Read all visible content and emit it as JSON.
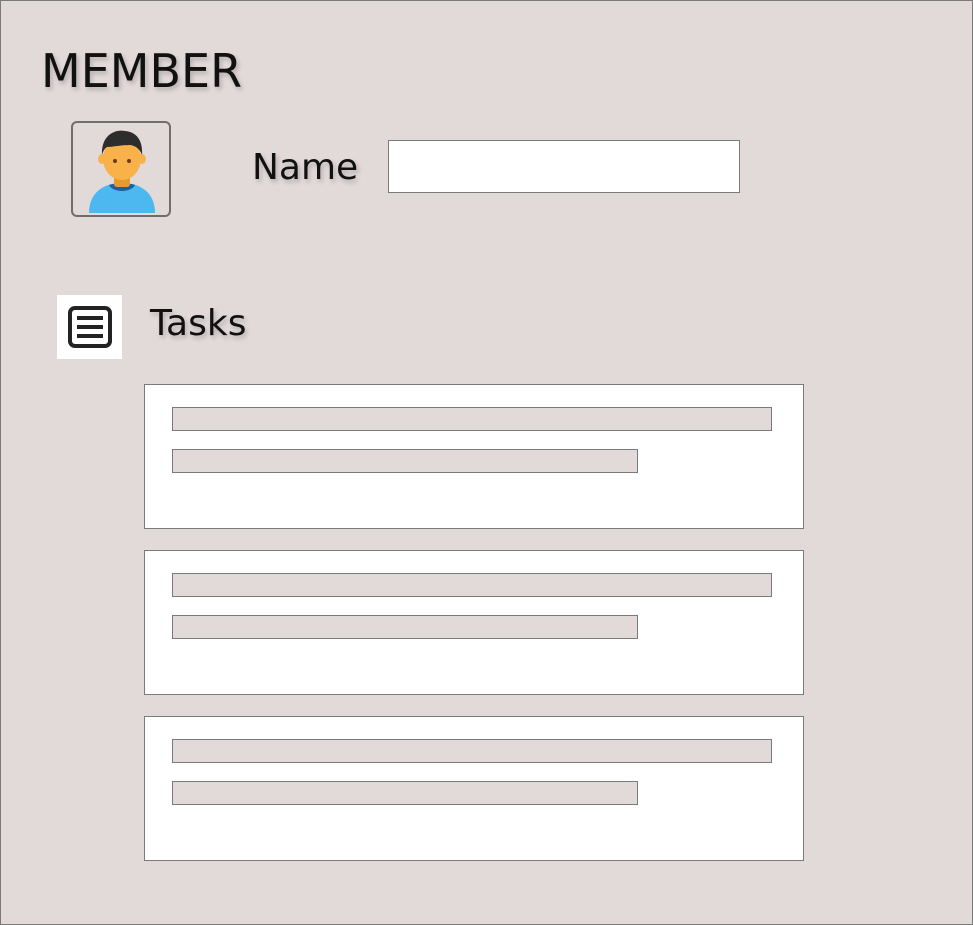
{
  "page": {
    "title": "MEMBER"
  },
  "member": {
    "avatar_icon": "user-avatar-icon",
    "name_label": "Name",
    "name_value": ""
  },
  "tasks": {
    "icon": "list-icon",
    "label": "Tasks",
    "items": [
      {
        "title": "",
        "detail": ""
      },
      {
        "title": "",
        "detail": ""
      },
      {
        "title": "",
        "detail": ""
      }
    ]
  },
  "colors": {
    "background": "#e2d9d9",
    "border": "#7a7a7a",
    "card": "#ffffff",
    "avatar_skin": "#f9b24a",
    "avatar_hair": "#2d2d2d",
    "avatar_shirt": "#4db8f0"
  }
}
